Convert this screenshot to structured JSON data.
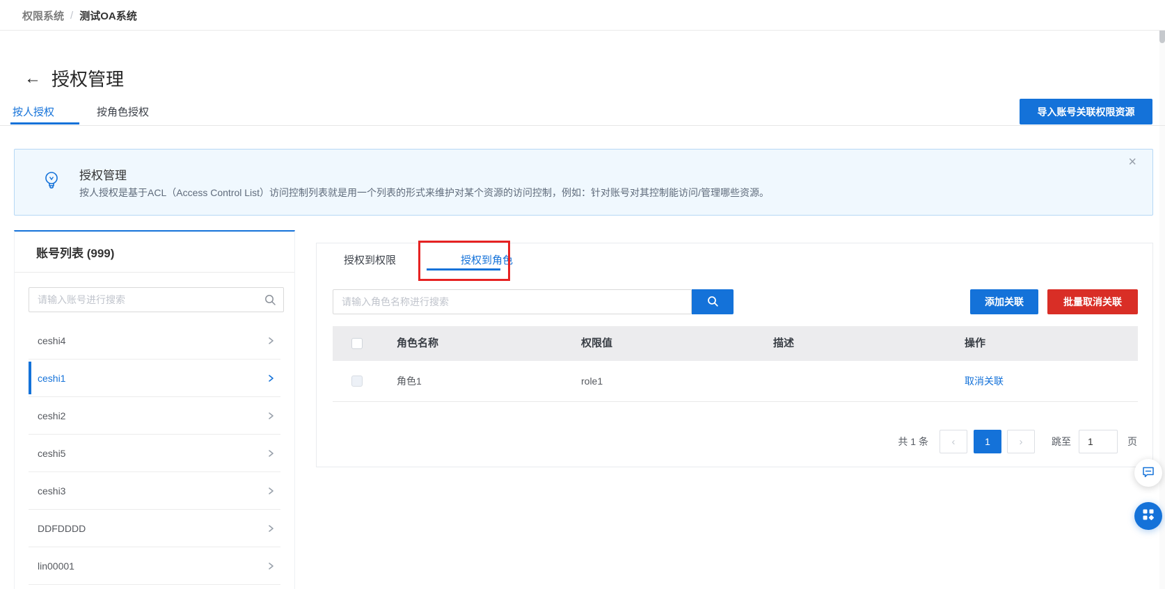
{
  "breadcrumb": {
    "parent": "权限系统",
    "separator": "/",
    "current": "测试OA系统"
  },
  "header": {
    "back_icon": "←",
    "title": "授权管理",
    "import_button": "导入账号关联权限资源"
  },
  "main_tabs": [
    {
      "label": "按人授权",
      "active": true
    },
    {
      "label": "按角色授权",
      "active": false
    }
  ],
  "banner": {
    "icon": "lightbulb-icon",
    "title": "授权管理",
    "description": "按人授权是基于ACL（Access Control List）访问控制列表就是用一个列表的形式来维护对某个资源的访问控制，例如：针对账号对其控制能访问/管理哪些资源。",
    "close_icon": "×"
  },
  "account_panel": {
    "title": "账号列表 (999)",
    "search_placeholder": "请输入账号进行搜索",
    "search_icon": "magnifier",
    "chevron_icon": "chevron-right",
    "items": [
      {
        "label": "ceshi4",
        "selected": false
      },
      {
        "label": "ceshi1",
        "selected": true
      },
      {
        "label": "ceshi2",
        "selected": false
      },
      {
        "label": "ceshi5",
        "selected": false
      },
      {
        "label": "ceshi3",
        "selected": false
      },
      {
        "label": "DDFDDDD",
        "selected": false
      },
      {
        "label": "lin00001",
        "selected": false
      }
    ]
  },
  "authorization_panel": {
    "tabs": [
      {
        "label": "授权到权限",
        "active": false
      },
      {
        "label": "授权到角色",
        "active": true,
        "annotated": true
      }
    ],
    "search_placeholder": "请输入角色名称进行搜索",
    "search_icon": "magnifier",
    "add_button": "添加关联",
    "batch_remove_button": "批量取消关联",
    "table": {
      "columns": [
        "角色名称",
        "权限值",
        "描述",
        "操作"
      ],
      "rows": [
        {
          "role_name": "角色1",
          "permission_value": "role1",
          "description": "",
          "action": "取消关联"
        }
      ]
    },
    "pagination": {
      "total": "共 1 条",
      "prev_icon": "‹",
      "current_page": "1",
      "next_icon": "›",
      "jump_label": "跳至",
      "jump_value": "1",
      "jump_unit": "页"
    }
  },
  "floating_buttons": [
    {
      "name": "feedback",
      "icon": "chat-bubble-icon"
    },
    {
      "name": "apps",
      "icon": "app-grid-icon"
    }
  ],
  "colors": {
    "primary": "#1472d9",
    "danger": "#d92e26",
    "annotation_red": "#e62222",
    "banner_bg": "#f0f8fe",
    "banner_border": "#b6d7f5",
    "table_header_bg": "#ececee"
  }
}
